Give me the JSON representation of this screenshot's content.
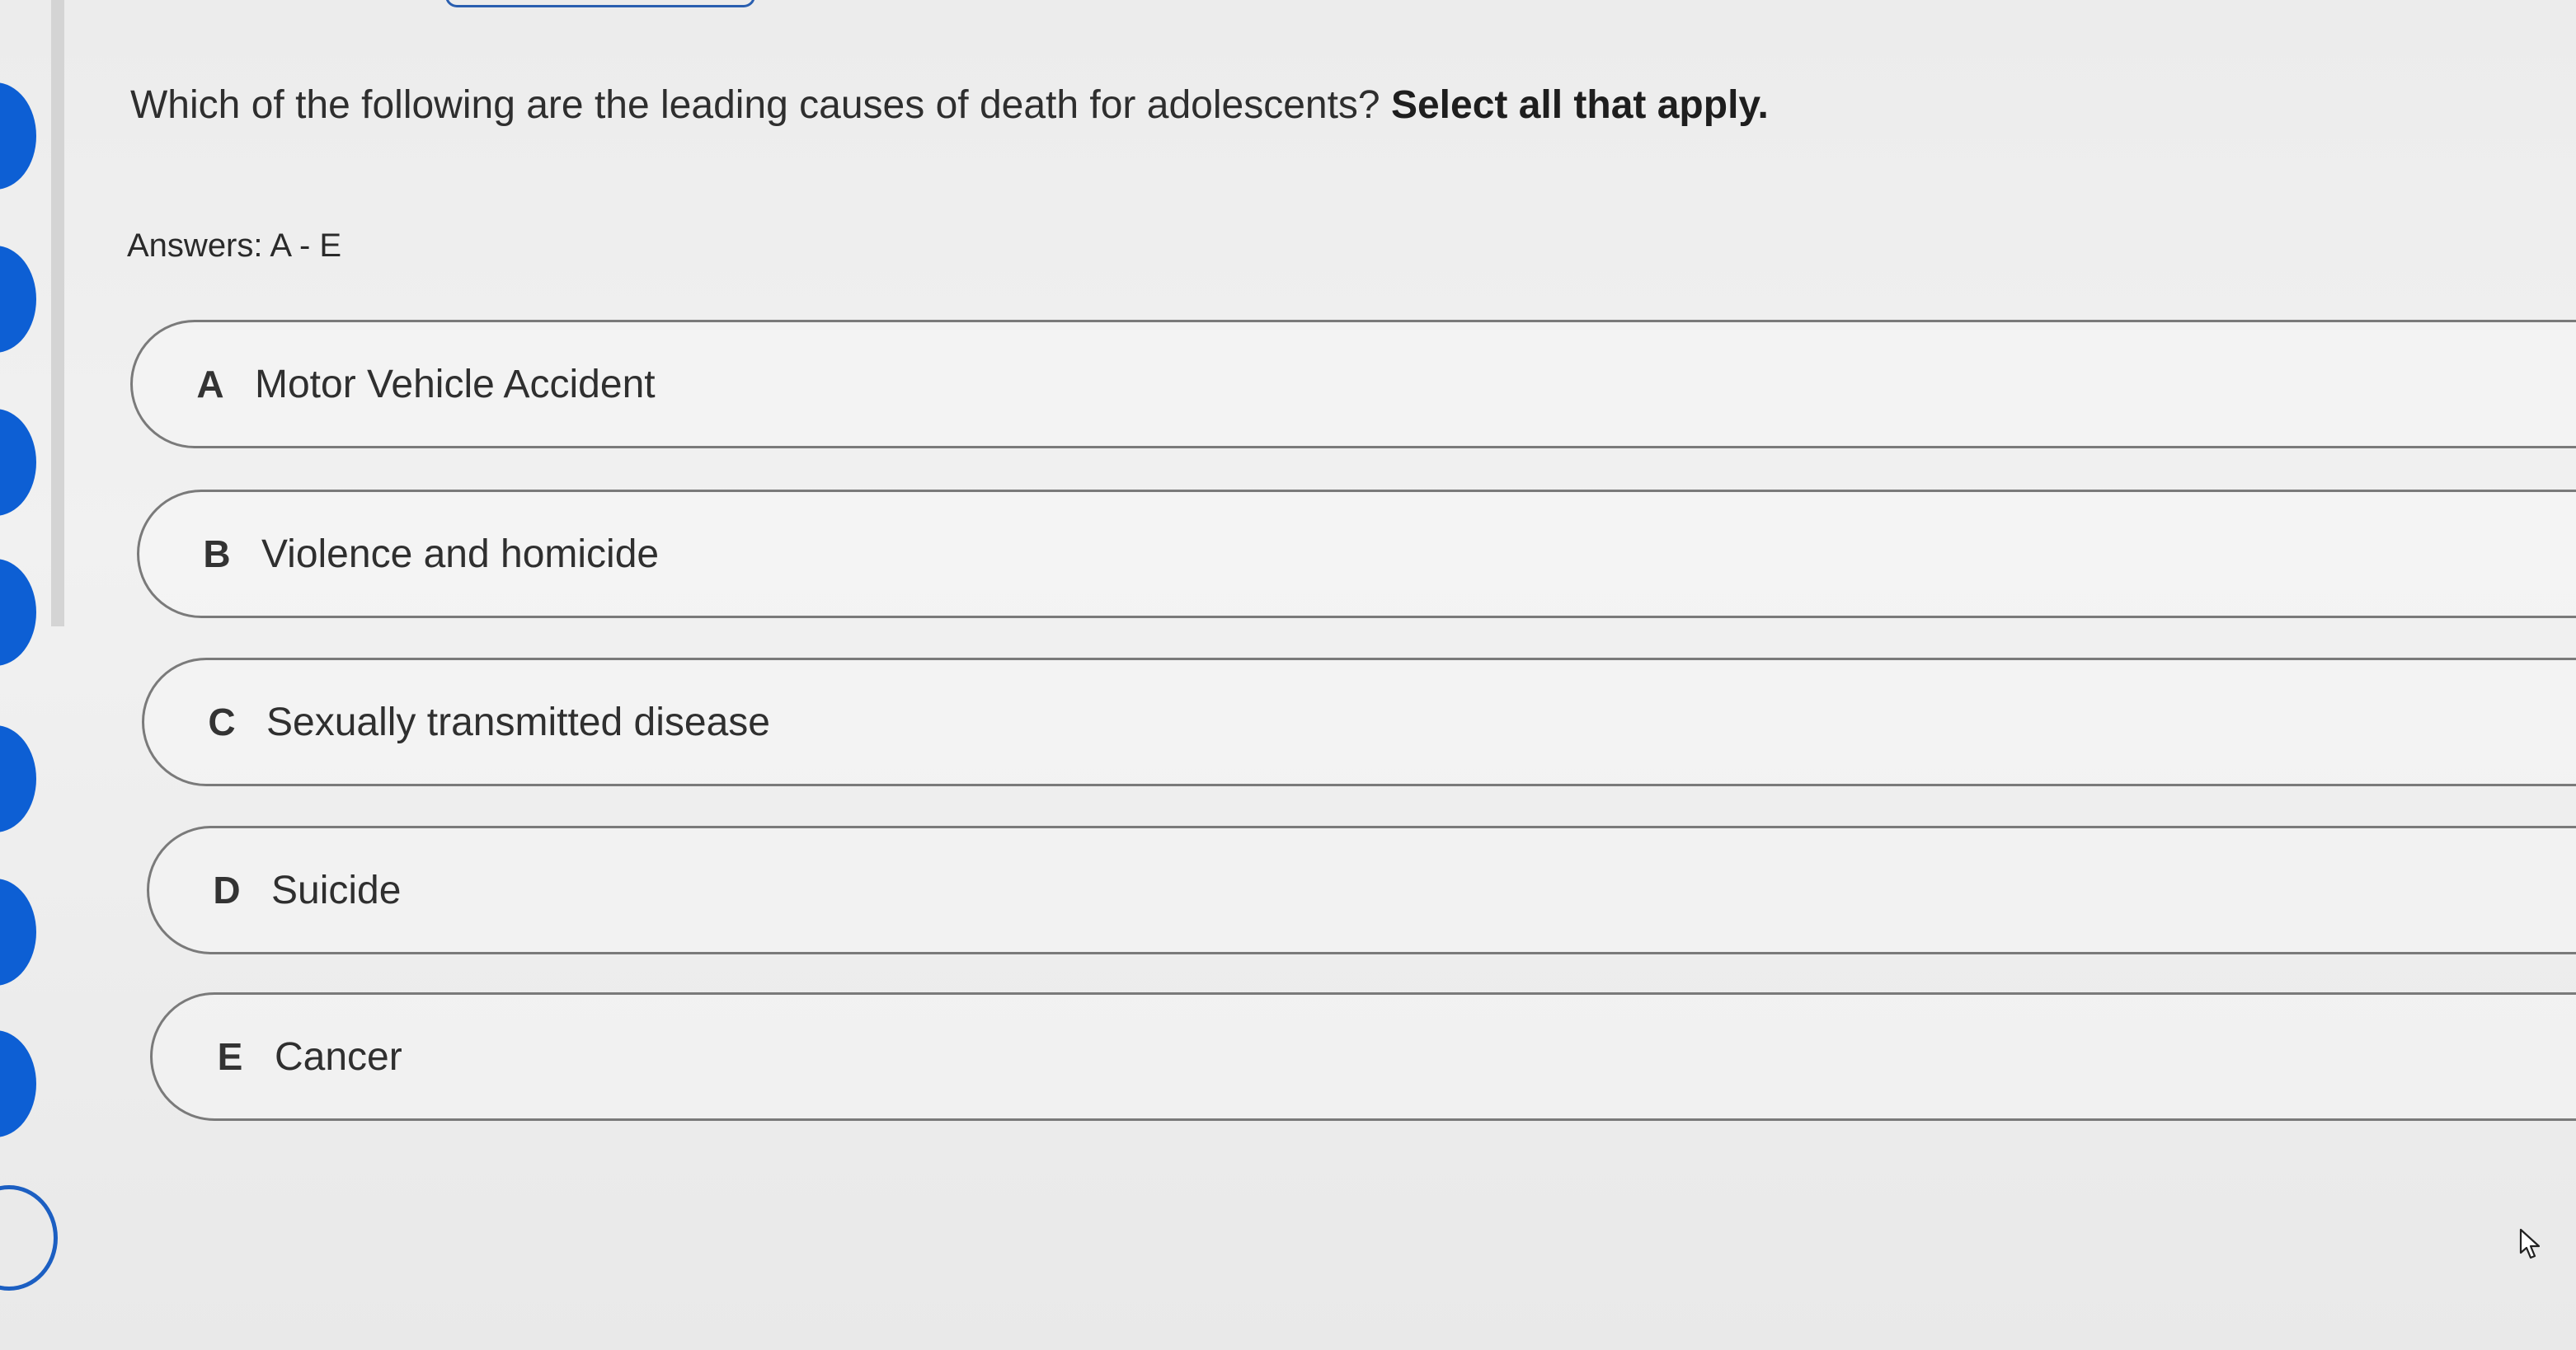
{
  "question": {
    "text": "Which of the following are the leading causes of death for adolescents?",
    "emphasis": "Select all that apply."
  },
  "answers_hint": "Answers: A - E",
  "options": [
    {
      "letter": "A",
      "label": "Motor Vehicle Accident"
    },
    {
      "letter": "B",
      "label": "Violence and homicide"
    },
    {
      "letter": "C",
      "label": "Sexually transmitted disease"
    },
    {
      "letter": "D",
      "label": "Suicide"
    },
    {
      "letter": "E",
      "label": "Cancer"
    }
  ],
  "colors": {
    "nav_dot": "#0d5fd4",
    "option_border": "#7a7a7a"
  },
  "icons": {
    "pointer": "mouse-pointer-icon"
  }
}
